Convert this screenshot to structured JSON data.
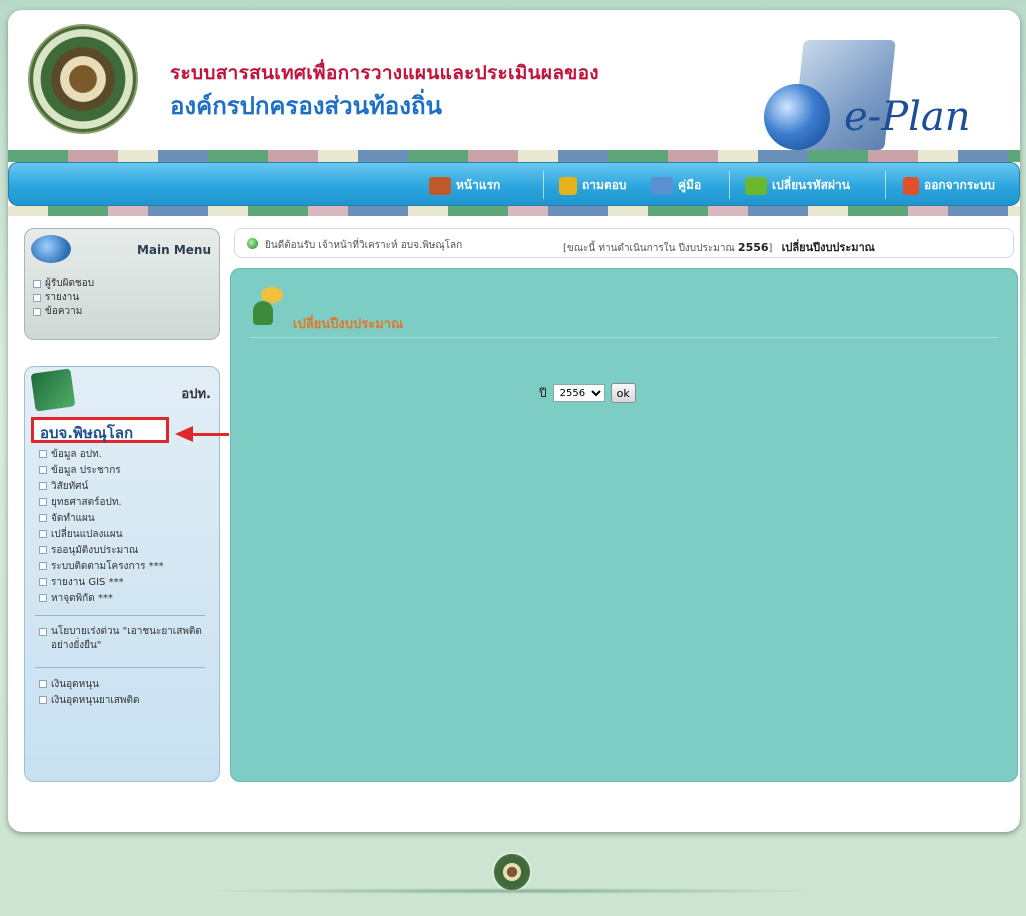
{
  "header": {
    "title_line1": "ระบบสารสนเทศเพื่อการวางแผนและประเมินผลของ",
    "title_line2": "องค์กรปกครองส่วนท้องถิ่น",
    "product": "e-Plan"
  },
  "nav": {
    "items": [
      {
        "label": "หน้าแรก",
        "icon": "home-icon",
        "color": "#c0582a"
      },
      {
        "label": "ถามตอบ",
        "icon": "question-icon",
        "color": "#e8b21c"
      },
      {
        "label": "คู่มือ",
        "icon": "book-icon",
        "color": "#5a8fd0"
      },
      {
        "label": "เปลี่ยนรหัสผ่าน",
        "icon": "key-icon",
        "color": "#6ab82e"
      },
      {
        "label": "ออกจากระบบ",
        "icon": "logout-icon",
        "color": "#e0502a"
      }
    ]
  },
  "main_menu": {
    "title": "Main Menu",
    "items": [
      "ผู้รับผิดชอบ",
      "รายงาน",
      "ข้อความ"
    ]
  },
  "opt_menu": {
    "title": "อปท.",
    "selected": "อบจ.พิษณุโลก",
    "items": [
      "ข้อมูล อปท.",
      "ข้อมูล ประชากร",
      "วิสัยทัศน์",
      "ยุทธศาสตร์อปท.",
      "จัดทำแผน",
      "เปลี่ยนแปลงแผน",
      "รออนุมัติงบประมาณ",
      "ระบบติดตามโครงการ ***",
      "รายงาน GIS ***",
      "หาจุดพิกัด ***"
    ],
    "policy_item": "นโยบายเร่งด่วน \"เอาชนะยาเสพติดอย่างยั่งยืน\"",
    "fund_items": [
      "เงินอุดหนุน",
      "เงินอุดหนุนยาเสพติด"
    ]
  },
  "info_bar": {
    "greeting": "ยินดีต้อนรับ เจ้าหน้าที่วิเคราะห์ อบจ.พิษณุโลก",
    "status_prefix": "[ขณะนี้ ท่านดำเนินการใน ปีงบประมาณ",
    "year": "2556",
    "status_suffix": "]",
    "link": "เปลี่ยนปีงบประมาณ"
  },
  "panel": {
    "title": "เปลี่ยนปีงบประมาณ",
    "year_label": "ปี",
    "year_value": "2556",
    "ok_label": "ok"
  }
}
